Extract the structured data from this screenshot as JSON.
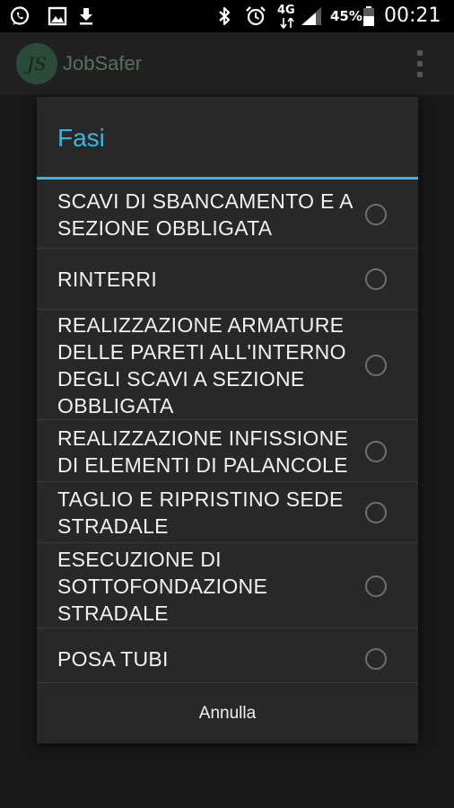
{
  "status_bar": {
    "network": "4G",
    "battery": "45%",
    "time": "00:21",
    "icons": [
      "whatsapp-icon",
      "gallery-icon",
      "download-icon",
      "bluetooth-icon",
      "alarm-icon",
      "signal-icon",
      "battery-icon"
    ]
  },
  "app_bar": {
    "logo_text": "JS",
    "title": "JobSafer",
    "menu_icon": "overflow-menu-icon"
  },
  "dialog": {
    "title": "Fasi",
    "accent_color": "#33b5e5",
    "options": [
      {
        "label": "SCAVI DI SBANCAMENTO E A SEZIONE OBBLIGATA",
        "selected": false
      },
      {
        "label": "RINTERRI",
        "selected": false
      },
      {
        "label": "REALIZZAZIONE ARMATURE DELLE PARETI ALL'INTERNO DEGLI SCAVI A SEZIONE OBBLIGATA",
        "selected": false
      },
      {
        "label": "REALIZZAZIONE INFISSIONE DI ELEMENTI DI PALANCOLE",
        "selected": false
      },
      {
        "label": "TAGLIO E RIPRISTINO SEDE STRADALE",
        "selected": false
      },
      {
        "label": "ESECUZIONE DI SOTTOFONDAZIONE STRADALE",
        "selected": false
      },
      {
        "label": "POSA TUBI",
        "selected": false
      }
    ],
    "cancel_label": "Annulla"
  }
}
